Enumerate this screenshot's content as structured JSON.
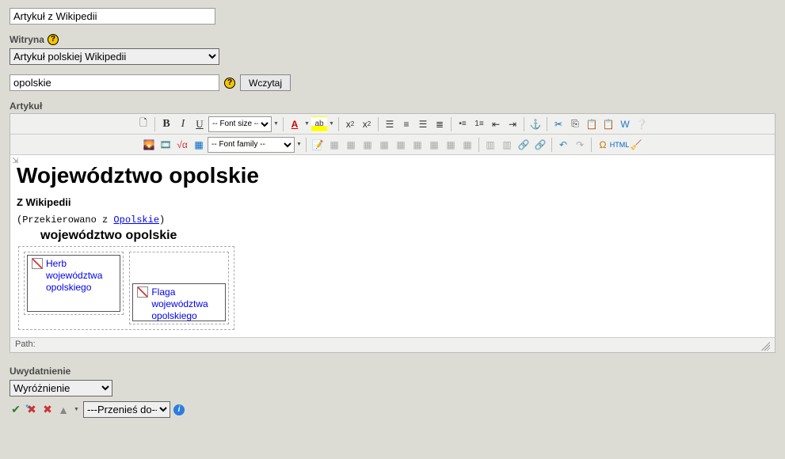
{
  "title_input": {
    "value": "Artykuł z Wikipedii"
  },
  "site": {
    "label": "Witryna",
    "selected": "Artykuł polskiej Wikipedii"
  },
  "load": {
    "keyword": "opolskie",
    "button": "Wczytaj"
  },
  "article_label": "Artykuł",
  "toolbar": {
    "fontsize_placeholder": "-- Font size --",
    "fontfamily_placeholder": "-- Font family --"
  },
  "article": {
    "heading": "Województwo opolskie",
    "subheading": "Z Wikipedii",
    "redir_prefix": "(Przekierowano z ",
    "redir_link": "Opolskie",
    "redir_suffix": ")",
    "infobox_title": "województwo opolskie",
    "herb_caption": "Herb województwa opolskiego",
    "flaga_caption": "Flaga województwa opolskiego"
  },
  "path_label": "Path:",
  "emphasis": {
    "label": "Uwydatnienie",
    "selected": "Wyróżnienie"
  },
  "move_select": {
    "selected": "---Przenieś do---"
  },
  "chart_data": null
}
